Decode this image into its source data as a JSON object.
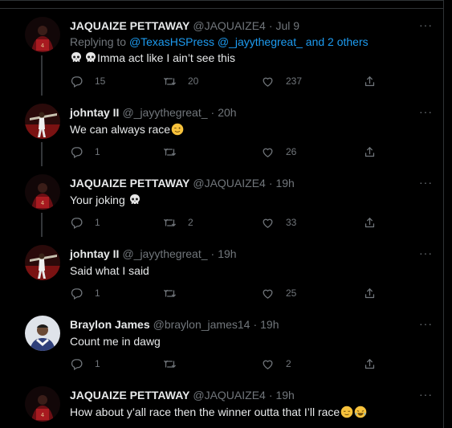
{
  "tweets": [
    {
      "name": "JAQUAIZE PETTAWAY",
      "handle": "@JAQUAIZE4",
      "time": "Jul 9",
      "replying_prefix": "Replying to ",
      "replying_links": "@TexasHSPress @_jayythegreat_ and 2 others",
      "text": "Imma act like I ain’t see this",
      "replies": "15",
      "retweets": "20",
      "likes": "237"
    },
    {
      "name": "johntay II",
      "handle": "@_jayythegreat_",
      "time": "20h",
      "text": "We can always race",
      "replies": "1",
      "retweets": "",
      "likes": "26"
    },
    {
      "name": "JAQUAIZE PETTAWAY",
      "handle": "@JAQUAIZE4",
      "time": "19h",
      "text": "Your joking",
      "replies": "1",
      "retweets": "2",
      "likes": "33"
    },
    {
      "name": "johntay II",
      "handle": "@_jayythegreat_",
      "time": "19h",
      "text": "Said what I said",
      "replies": "1",
      "retweets": "",
      "likes": "25"
    },
    {
      "name": "Braylon James",
      "handle": "@braylon_james14",
      "time": "19h",
      "text": "Count me in dawg",
      "replies": "1",
      "retweets": "",
      "likes": "2"
    },
    {
      "name": "JAQUAIZE PETTAWAY",
      "handle": "@JAQUAIZE4",
      "time": "19h",
      "text": "How about y’all race then the winner outta that I’ll race"
    }
  ],
  "separator": "·",
  "more_label": "···",
  "colors": {
    "background": "#000000",
    "text": "#e7e9ea",
    "muted": "#71767b",
    "link": "#1d9bf0"
  },
  "icons": [
    "reply-icon",
    "retweet-icon",
    "like-icon",
    "share-icon",
    "skull-emoji",
    "wink-emoji",
    "relieved-emoji",
    "joy-emoji"
  ]
}
